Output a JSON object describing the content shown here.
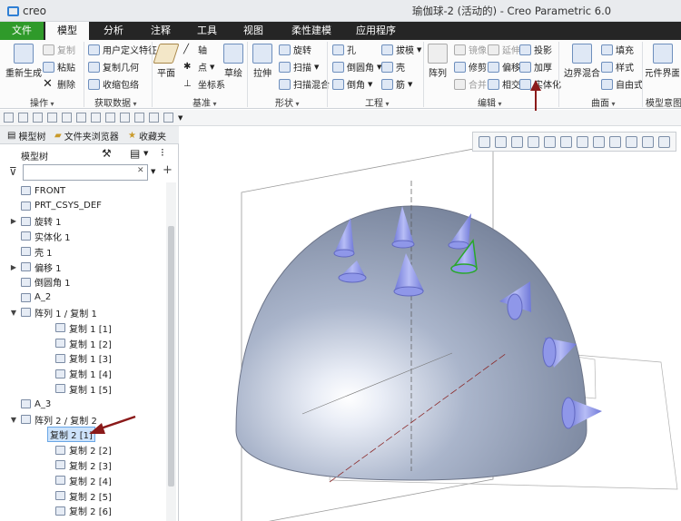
{
  "app": {
    "logo": "creo",
    "window_title": "瑜伽球-2 (活动的) - Creo Parametric 6.0"
  },
  "menu": {
    "items": [
      "文件",
      "模型",
      "分析",
      "注释",
      "工具",
      "视图",
      "柔性建模",
      "应用程序"
    ]
  },
  "ribbon": {
    "operations": {
      "label": "操作",
      "regenerate": "重新生成",
      "copy": "复制",
      "paste": "粘贴",
      "delete": "删除"
    },
    "getdata": {
      "label": "获取数据",
      "udf": "用户定义特征",
      "copy_geom": "复制几何",
      "shrinkwrap": "收缩包络"
    },
    "datum": {
      "label": "基准",
      "plane": "平面",
      "axis": "轴",
      "point": "点",
      "csys": "坐标系",
      "sketch": "草绘"
    },
    "shapes": {
      "label": "形状",
      "extrude": "拉伸",
      "revolve": "旋转",
      "sweep": "扫描",
      "swept_blend": "扫描混合"
    },
    "engineering": {
      "label": "工程",
      "hole": "孔",
      "round": "倒圆角",
      "chamfer": "倒角",
      "draft": "拔模",
      "shell": "壳",
      "rib": "筋"
    },
    "editing": {
      "label": "编辑",
      "pattern": "阵列",
      "mirror": "镜像",
      "extend": "延伸",
      "project": "投影",
      "trim": "修剪",
      "offset": "偏移",
      "thicken": "加厚",
      "merge": "合并",
      "intersect": "相交",
      "solidify": "实体化"
    },
    "surfaces": {
      "label": "曲面",
      "boundary_blend": "边界混合",
      "fill": "填充",
      "style": "样式",
      "freestyle": "自由式"
    },
    "intent": {
      "label": "模型意图",
      "component_interface": "元件界面"
    }
  },
  "panel": {
    "tabs": [
      "模型树",
      "文件夹浏览器",
      "收藏夹"
    ],
    "tree_header": "模型树",
    "search": {
      "value": ""
    },
    "tree": [
      {
        "label": "FRONT",
        "expander": "",
        "depth": 0
      },
      {
        "label": "PRT_CSYS_DEF",
        "expander": "",
        "depth": 0
      },
      {
        "label": "旋转 1",
        "expander": "▶",
        "depth": 0
      },
      {
        "label": "实体化 1",
        "expander": "",
        "depth": 0
      },
      {
        "label": "壳 1",
        "expander": "",
        "depth": 0
      },
      {
        "label": "偏移 1",
        "expander": "▶",
        "depth": 0
      },
      {
        "label": "倒圆角 1",
        "expander": "",
        "depth": 0
      },
      {
        "label": "A_2",
        "expander": "",
        "depth": 0
      },
      {
        "label": "阵列 1 / 复制 1",
        "expander": "▼",
        "depth": 0
      },
      {
        "label": "复制 1 [1]",
        "expander": "",
        "depth": 1
      },
      {
        "label": "复制 1 [2]",
        "expander": "",
        "depth": 1
      },
      {
        "label": "复制 1 [3]",
        "expander": "",
        "depth": 1
      },
      {
        "label": "复制 1 [4]",
        "expander": "",
        "depth": 1
      },
      {
        "label": "复制 1 [5]",
        "expander": "",
        "depth": 1
      },
      {
        "label": "A_3",
        "expander": "",
        "depth": 0
      },
      {
        "label": "阵列 2 / 复制 2",
        "expander": "▼",
        "depth": 0
      },
      {
        "label": "复制 2 [1]",
        "expander": "",
        "depth": 1,
        "selected": true
      },
      {
        "label": "复制 2 [2]",
        "expander": "",
        "depth": 1
      },
      {
        "label": "复制 2 [3]",
        "expander": "",
        "depth": 1
      },
      {
        "label": "复制 2 [4]",
        "expander": "",
        "depth": 1
      },
      {
        "label": "复制 2 [5]",
        "expander": "",
        "depth": 1
      },
      {
        "label": "复制 2 [6]",
        "expander": "",
        "depth": 1
      }
    ]
  },
  "colors": {
    "accent": "#2f9a2a",
    "menubar": "#252525",
    "spike": "#8c96e8",
    "dome": "#9aa6bd",
    "annotation_arrow": "#8b1a1a"
  }
}
